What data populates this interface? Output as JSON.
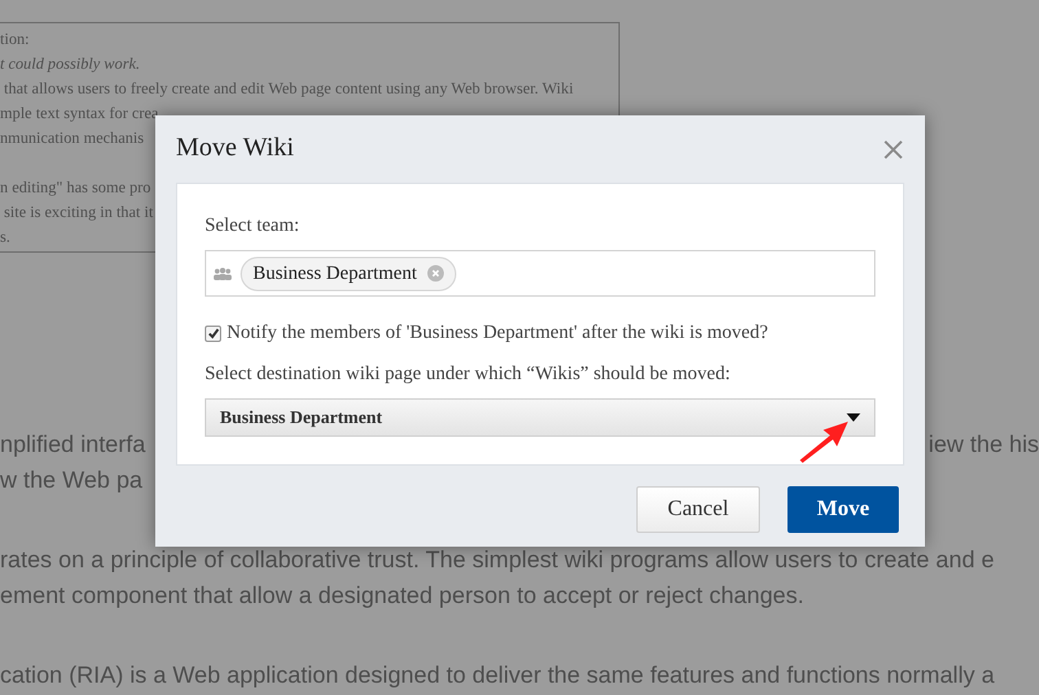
{
  "background": {
    "box_paragraphs": [
      [
        {
          "text": "tion:",
          "italic": false
        },
        {
          "text": "t could possibly work.",
          "italic": true
        },
        {
          "text": " that allows users to freely create and edit Web page content using any Web browser. Wiki",
          "italic": false
        },
        {
          "text": "mple text syntax for crea",
          "italic": false
        },
        {
          "text": "nmunication mechanis",
          "italic": false
        }
      ],
      [
        {
          "text": "n editing\" has some pro",
          "italic": false
        },
        {
          "text": " site is exciting in that it",
          "italic": false
        },
        {
          "text": "s.",
          "italic": false
        }
      ]
    ],
    "paragraphs": [
      [
        {
          "left": "nplified interfa",
          "right": "iew the his"
        },
        {
          "left": "w the Web pa"
        }
      ],
      [
        {
          "left": "rates on a principle of collaborative trust. The simplest wiki programs allow users to create and e"
        },
        {
          "left": "ement component that allow a designated person to accept or reject changes."
        }
      ],
      [
        {
          "left": "cation (RIA) is a Web application designed to deliver the same features and functions normally a"
        }
      ]
    ]
  },
  "dialog": {
    "title": "Move Wiki",
    "team_label": "Select team:",
    "team_tags": [
      {
        "label": "Business Department"
      }
    ],
    "notify": {
      "label": "Notify the members of 'Business Department' after the wiki is moved?",
      "checked": true
    },
    "destination_label": "Select destination wiki page under which “Wikis” should be moved:",
    "destination": {
      "value": "Business Department"
    },
    "buttons": [
      {
        "label": "Cancel",
        "kind": "secondary"
      },
      {
        "label": "Move",
        "kind": "primary"
      }
    ]
  }
}
